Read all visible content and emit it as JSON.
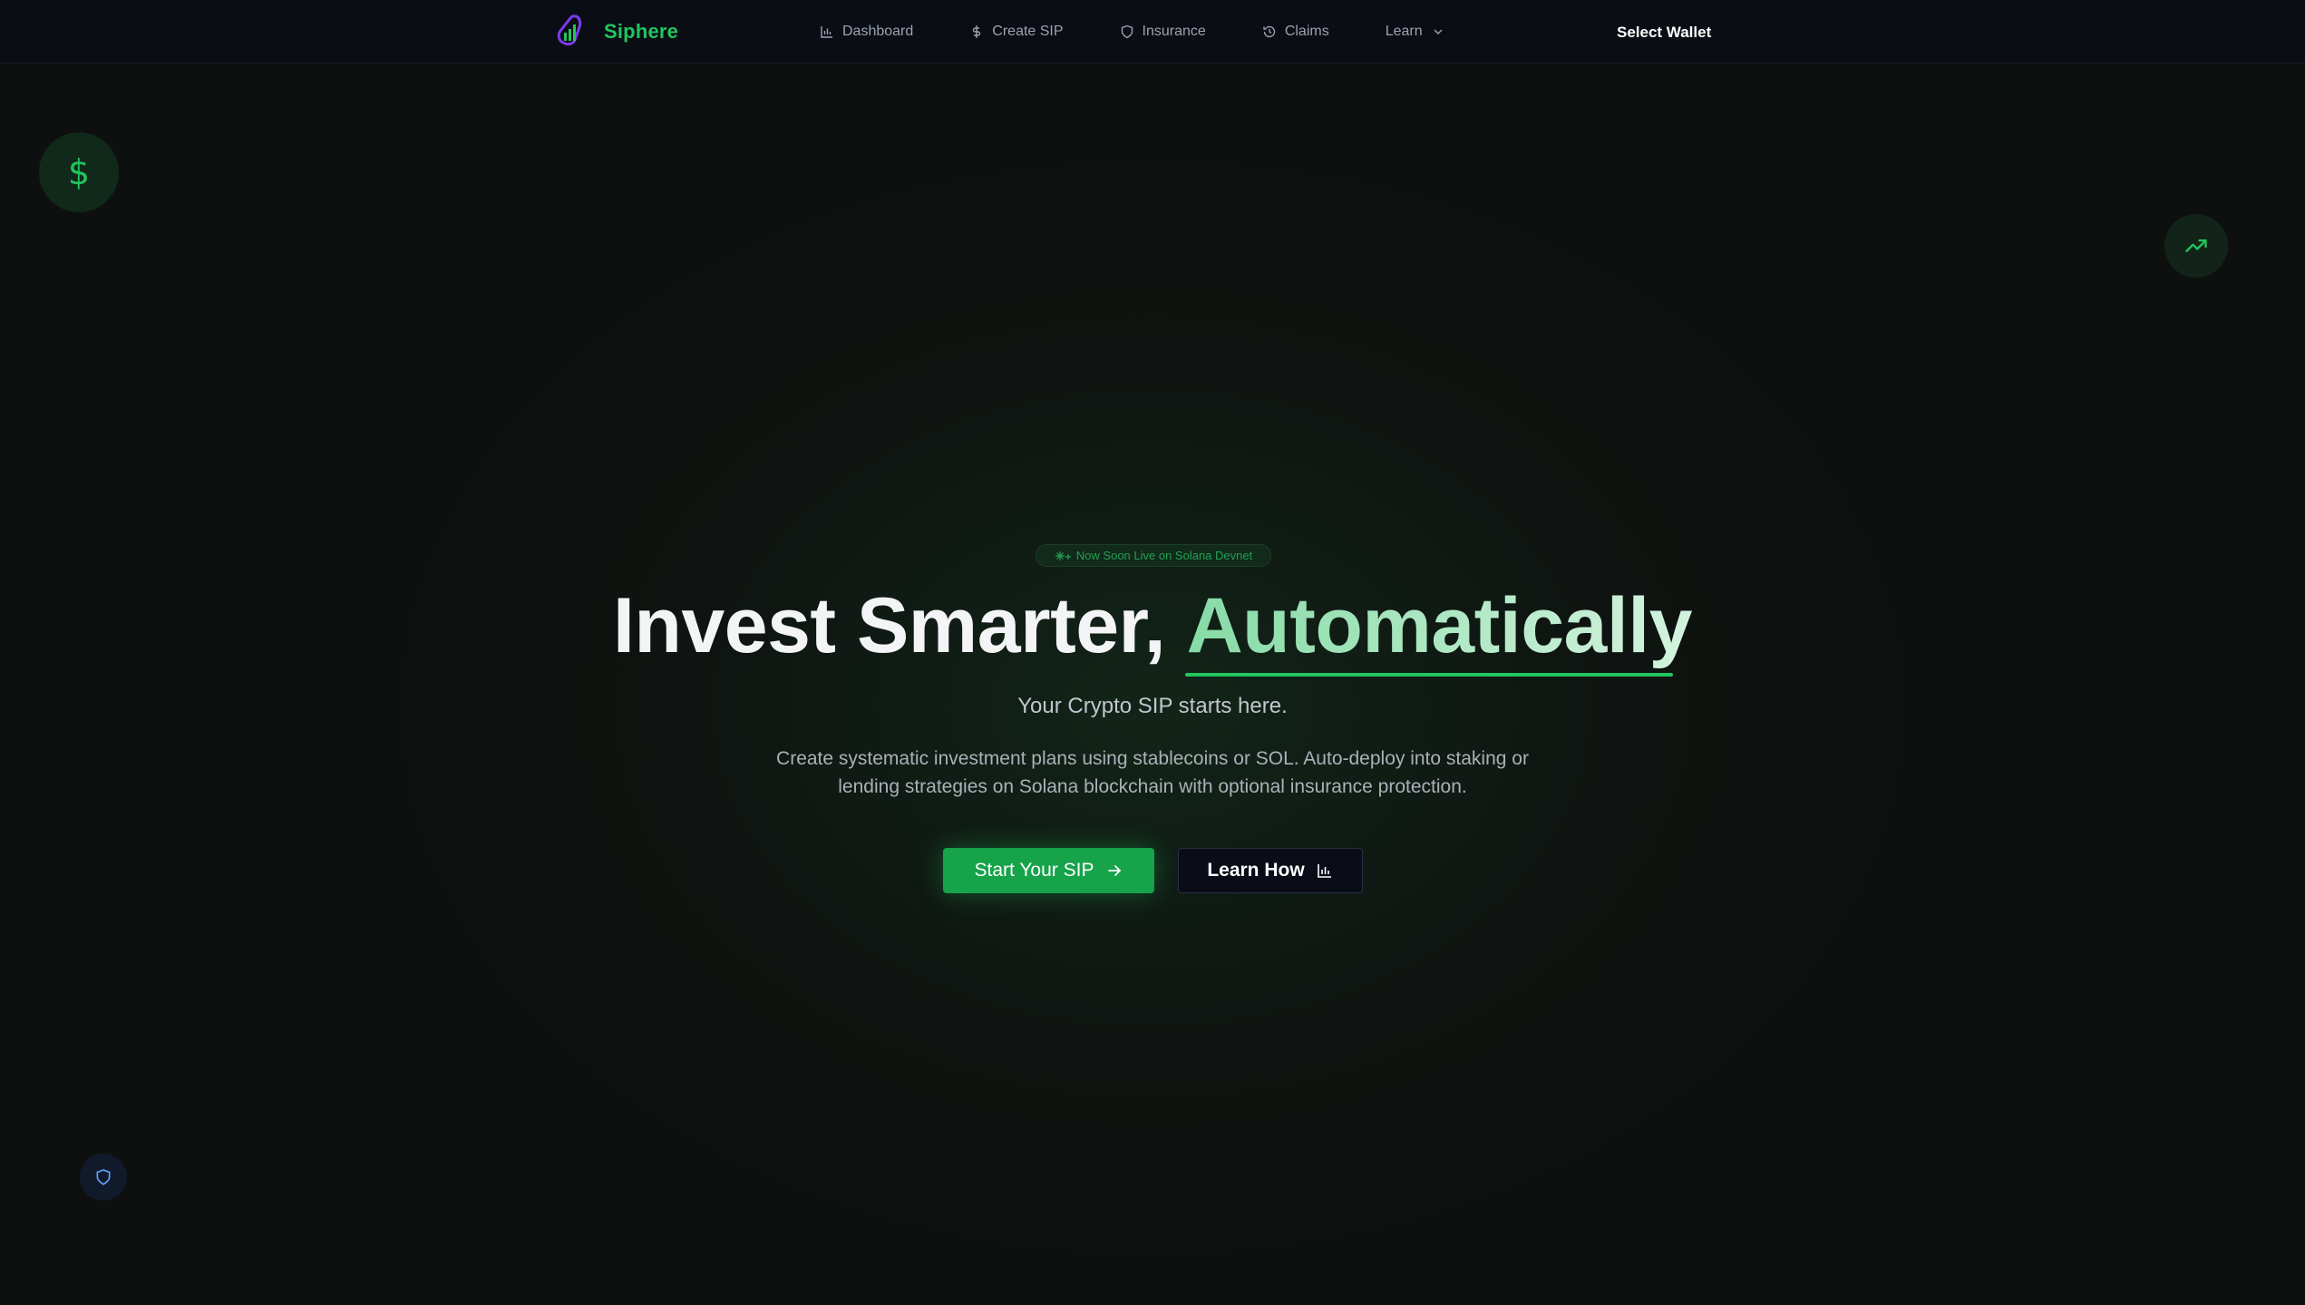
{
  "brand": {
    "name": "Siphere",
    "logo_icon": "chart-bars-logo-icon"
  },
  "nav": {
    "items": [
      {
        "label": "Dashboard",
        "icon": "bar-chart-icon"
      },
      {
        "label": "Create SIP",
        "icon": "dollar-icon"
      },
      {
        "label": "Insurance",
        "icon": "shield-icon"
      },
      {
        "label": "Claims",
        "icon": "history-icon"
      },
      {
        "label": "Learn",
        "icon": "chevron-down-icon"
      }
    ],
    "wallet_button": "Select Wallet"
  },
  "hero": {
    "badge": "Now Soon Live on Solana Devnet",
    "headline_part1": "Invest Smarter, ",
    "headline_part2": "Automatically",
    "subhead": "Your Crypto SIP starts here.",
    "description": "Create systematic investment plans using stablecoins or SOL. Auto-deploy into staking or lending strategies on Solana blockchain with optional insurance protection.",
    "primary_button": "Start Your SIP",
    "secondary_button": "Learn How"
  },
  "decor": {
    "dollar_bubble_glyph": "$",
    "icons": [
      "dollar-icon",
      "trending-up-icon",
      "shield-icon"
    ]
  },
  "colors": {
    "accent": "#22c55e",
    "accent_dark": "#16a34a",
    "navbar_bg": "#0a0d14",
    "page_bg": "#0e100f",
    "headline_gradient": [
      "#86dba6",
      "#d4f3df"
    ]
  }
}
